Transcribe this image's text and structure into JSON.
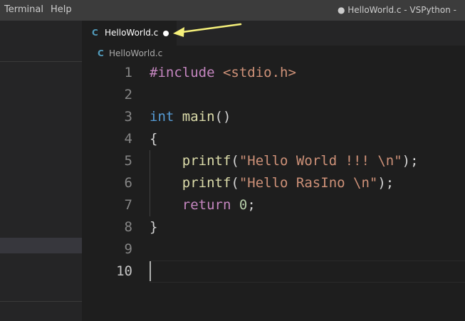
{
  "menubar": {
    "items": [
      "Terminal",
      "Help"
    ],
    "window_title": "● HelloWorld.c - VSPython -"
  },
  "tab": {
    "icon": "C",
    "label": "HelloWorld.c",
    "modified": true
  },
  "breadcrumb": {
    "icon": "C",
    "label": "HelloWorld.c"
  },
  "editor": {
    "active_line": 10,
    "lines": [
      {
        "number": "1",
        "tokens": [
          {
            "t": "#include",
            "c": "kw-ctl"
          },
          {
            "t": " ",
            "c": "pl"
          },
          {
            "t": "<stdio.h>",
            "c": "str"
          }
        ]
      },
      {
        "number": "2",
        "tokens": []
      },
      {
        "number": "3",
        "tokens": [
          {
            "t": "int",
            "c": "kw"
          },
          {
            "t": " ",
            "c": "pl"
          },
          {
            "t": "main",
            "c": "fn"
          },
          {
            "t": "()",
            "c": "pl"
          }
        ]
      },
      {
        "number": "4",
        "tokens": [
          {
            "t": "{",
            "c": "pl"
          }
        ]
      },
      {
        "number": "5",
        "tokens": [
          {
            "t": "    ",
            "c": "pl"
          },
          {
            "t": "printf",
            "c": "fn"
          },
          {
            "t": "(",
            "c": "pl"
          },
          {
            "t": "\"Hello World !!! \\n\"",
            "c": "str"
          },
          {
            "t": ");",
            "c": "pl"
          }
        ]
      },
      {
        "number": "6",
        "tokens": [
          {
            "t": "    ",
            "c": "pl"
          },
          {
            "t": "printf",
            "c": "fn"
          },
          {
            "t": "(",
            "c": "pl"
          },
          {
            "t": "\"Hello RasIno \\n\"",
            "c": "str"
          },
          {
            "t": ");",
            "c": "pl"
          }
        ]
      },
      {
        "number": "7",
        "tokens": [
          {
            "t": "    ",
            "c": "pl"
          },
          {
            "t": "return",
            "c": "kw-ctl"
          },
          {
            "t": " ",
            "c": "pl"
          },
          {
            "t": "0",
            "c": "num"
          },
          {
            "t": ";",
            "c": "pl"
          }
        ]
      },
      {
        "number": "8",
        "tokens": [
          {
            "t": "}",
            "c": "pl"
          }
        ]
      },
      {
        "number": "9",
        "tokens": []
      },
      {
        "number": "10",
        "tokens": []
      }
    ]
  },
  "colors": {
    "annotation_arrow": "#f5f07a",
    "c_icon": "#519aba"
  }
}
